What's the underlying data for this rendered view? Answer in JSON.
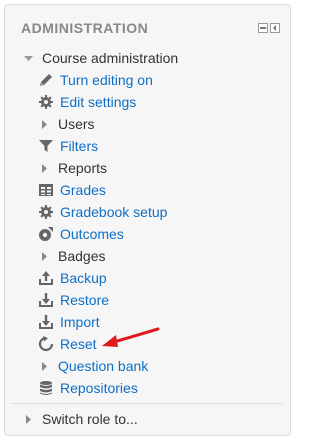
{
  "block": {
    "title": "ADMINISTRATION",
    "section_title": "Course administration",
    "items": [
      {
        "label": "Turn editing on",
        "icon": "pencil-icon"
      },
      {
        "label": "Edit settings",
        "icon": "gear-icon"
      },
      {
        "label": "Users",
        "icon": "expand-arrow"
      },
      {
        "label": "Filters",
        "icon": "filter-icon"
      },
      {
        "label": "Reports",
        "icon": "expand-arrow"
      },
      {
        "label": "Grades",
        "icon": "grades-table-icon"
      },
      {
        "label": "Gradebook setup",
        "icon": "gear-icon"
      },
      {
        "label": "Outcomes",
        "icon": "outcomes-icon"
      },
      {
        "label": "Badges",
        "icon": "expand-arrow"
      },
      {
        "label": "Backup",
        "icon": "backup-icon"
      },
      {
        "label": "Restore",
        "icon": "restore-icon"
      },
      {
        "label": "Import",
        "icon": "import-icon"
      },
      {
        "label": "Reset",
        "icon": "reset-icon"
      },
      {
        "label": "Question bank",
        "icon": "expand-arrow"
      },
      {
        "label": "Repositories",
        "icon": "database-icon"
      }
    ],
    "footer_item": "Switch role to..."
  },
  "colors": {
    "link": "#0f6fc5",
    "icon": "#666666",
    "annotation_arrow": "#e0191f"
  }
}
